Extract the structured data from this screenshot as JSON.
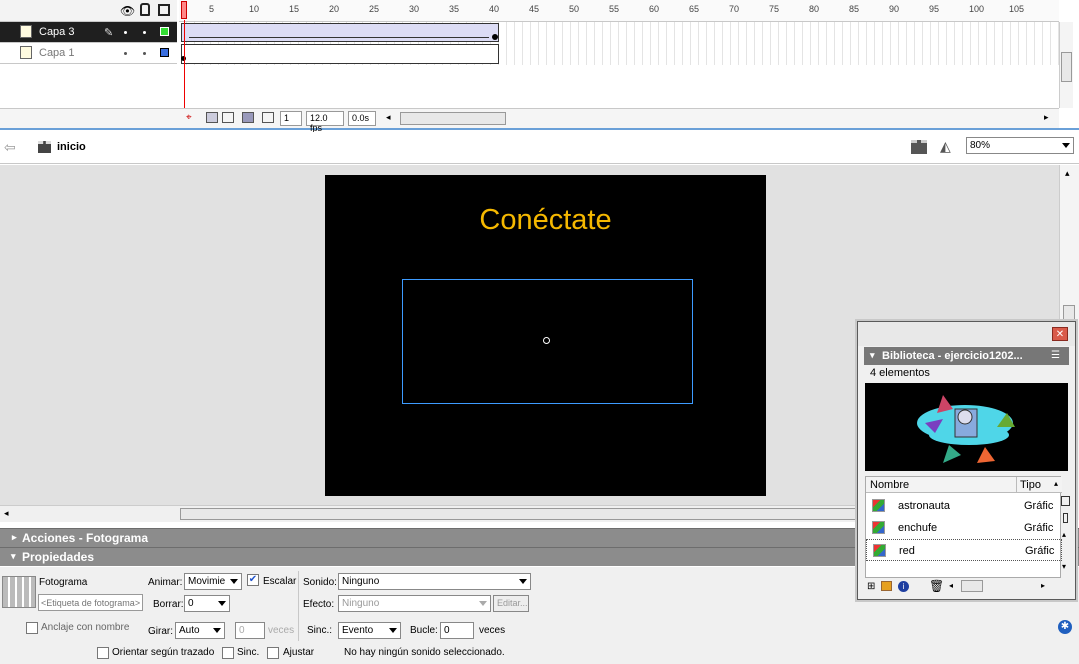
{
  "timeline": {
    "ruler_labels": [
      "5",
      "10",
      "15",
      "20",
      "25",
      "30",
      "35",
      "40",
      "45",
      "50",
      "55",
      "60",
      "65",
      "70",
      "75",
      "80",
      "85",
      "90",
      "95",
      "100",
      "105"
    ],
    "layers": [
      {
        "name": "Capa 3",
        "selected": true,
        "color": "#33dd33"
      },
      {
        "name": "Capa 1",
        "selected": false,
        "color": "#3a6fe0"
      }
    ],
    "current_frame": "1",
    "fps": "12.0 fps",
    "time": "0.0s"
  },
  "editbar": {
    "scene_name": "inicio",
    "zoom": "80%"
  },
  "stage": {
    "title": "Conéctate"
  },
  "panels": {
    "actions_title": "Acciones - Fotograma",
    "properties_title": "Propiedades"
  },
  "properties": {
    "type_label": "Fotograma",
    "frame_label_placeholder": "<Etiqueta de fotograma>",
    "anchor_label": "Anclaje con nombre",
    "animate_label": "Animar:",
    "animate_value": "Movimie",
    "scale_label": "Escalar",
    "ease_label": "Borrar:",
    "ease_value": "0",
    "rotate_label": "Girar:",
    "rotate_value": "Auto",
    "rotate_times": "0",
    "times_label": "veces",
    "orient_label": "Orientar según trazado",
    "sync_chk_label": "Sinc.",
    "snap_label": "Ajustar",
    "sound_label": "Sonido:",
    "sound_value": "Ninguno",
    "effect_label": "Efecto:",
    "effect_value": "Ninguno",
    "edit_button": "Editar...",
    "sync_label": "Sinc.:",
    "sync_value": "Evento",
    "loop_label": "Bucle:",
    "loop_value": "0",
    "loop_unit": "veces",
    "sound_status": "No hay ningún sonido seleccionado."
  },
  "library": {
    "title": "Biblioteca - ejercicio1202...",
    "count": "4 elementos",
    "col_name": "Nombre",
    "col_type": "Tipo",
    "items": [
      {
        "name": "astronauta",
        "type": "Gráfic"
      },
      {
        "name": "enchufe",
        "type": "Gráfic"
      },
      {
        "name": "red",
        "type": "Gráfic"
      }
    ]
  }
}
